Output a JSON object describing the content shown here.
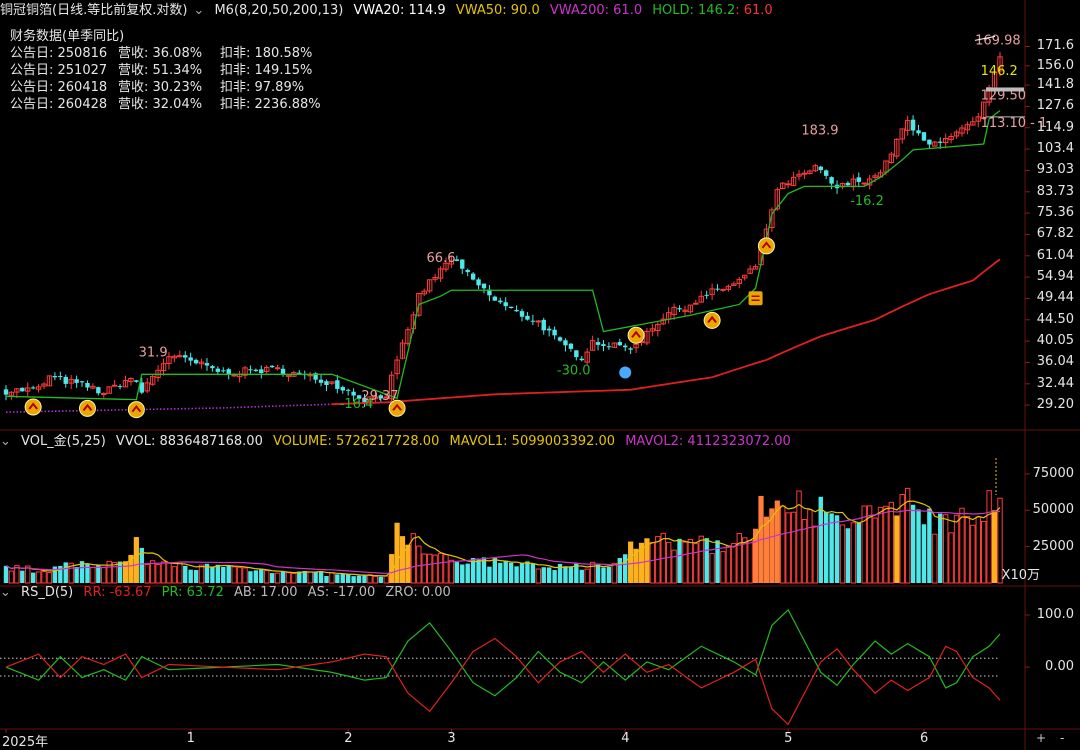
{
  "main_header": {
    "title": "铜冠铜箔(日线.等比前复权.对数)",
    "indicator": "M6(8,20,50,200,13)",
    "vwa20": "VWA20: 114.9",
    "vwa50": "VWA50: 90.0",
    "vwa200": "VWA200: 61.0",
    "hold": "HOLD: 146.2",
    "hold_extra": ": 61.0",
    "colors": {
      "vwa20": "#ffffff",
      "vwa50": "#e6c400",
      "vwa200": "#cc33cc",
      "hold": "#22bb22",
      "hold_extra": "#ff3333"
    }
  },
  "financial_box": {
    "title": "财务数据(单季同比)",
    "rows": [
      {
        "date": "公告日: 250816",
        "rev": "营收:  36.08%",
        "net": "扣非:  180.58%"
      },
      {
        "date": "公告日: 251027",
        "rev": "营收:  51.34%",
        "net": "扣非:  149.15%"
      },
      {
        "date": "公告日: 260418",
        "rev": "营收:  30.23%",
        "net": "扣非:  97.89%"
      },
      {
        "date": "公告日: 260428",
        "rev": "营收:  32.04%",
        "net": "扣非:  2236.88%"
      }
    ]
  },
  "vol_header": {
    "name": "VOL_金(5,25)",
    "vvol": "VVOL: 8836487168.00",
    "volume": "VOLUME: 5726217728.00",
    "mavol1": "MAVOL1: 5099003392.00",
    "mavol2": "MAVOL2: 4112323072.00"
  },
  "rs_header": {
    "name": "RS_D(5)",
    "rr": "RR: -63.67",
    "pr": "PR: 63.72",
    "ab": "AB: 17.00",
    "as": "AS: -17.00",
    "zro": "ZRO: 0.00"
  },
  "controls": {
    "plus": "+",
    "minus": "-"
  },
  "chart_data": [
    {
      "type": "candlestick",
      "scale": "log",
      "y_ticks": [
        "171.6",
        "156.0",
        "141.8",
        "127.6",
        "114.9",
        "103.4",
        "93.03",
        "83.73",
        "75.36",
        "67.82",
        "61.04",
        "54.94",
        "49.44",
        "44.50",
        "40.05",
        "36.04",
        "32.44",
        "29.20"
      ],
      "y_tick_values": [
        171.6,
        156.0,
        141.8,
        127.6,
        114.9,
        103.4,
        93.03,
        83.73,
        75.36,
        67.82,
        61.04,
        54.94,
        49.44,
        44.5,
        40.05,
        36.04,
        32.44,
        29.2
      ],
      "ylim": [
        26.6,
        188
      ],
      "x_ticks": [
        "2025年",
        "1",
        "2",
        "3",
        "4",
        "5",
        "6"
      ],
      "x_tick_index": [
        0,
        34,
        63,
        82,
        114,
        144,
        169
      ],
      "price_points": [
        [
          0,
          31.3
        ],
        [
          6,
          31.6
        ],
        [
          8,
          33.5
        ],
        [
          15,
          32.0
        ],
        [
          18,
          31.0
        ],
        [
          23,
          33.4
        ],
        [
          25,
          31.2
        ],
        [
          29,
          36.0
        ],
        [
          30,
          37.3
        ],
        [
          34,
          36.2
        ],
        [
          40,
          34.3
        ],
        [
          50,
          34.8
        ],
        [
          60,
          32.6
        ],
        [
          66,
          30.0
        ],
        [
          70,
          30.8
        ],
        [
          72,
          36.0
        ],
        [
          74,
          42.0
        ],
        [
          76,
          50.0
        ],
        [
          78,
          53.5
        ],
        [
          82,
          60.0
        ],
        [
          86,
          54.0
        ],
        [
          90,
          49.0
        ],
        [
          94,
          46.0
        ],
        [
          98,
          44.0
        ],
        [
          102,
          39.5
        ],
        [
          106,
          37.0
        ],
        [
          108,
          40.0
        ],
        [
          112,
          39.0
        ],
        [
          116,
          39.0
        ],
        [
          118,
          42.0
        ],
        [
          122,
          46.0
        ],
        [
          126,
          48.0
        ],
        [
          130,
          51.0
        ],
        [
          134,
          53.0
        ],
        [
          136,
          55.0
        ],
        [
          138,
          58.0
        ],
        [
          140,
          70.0
        ],
        [
          142,
          84.0
        ],
        [
          144,
          88.0
        ],
        [
          146,
          90.0
        ],
        [
          149,
          94.0
        ],
        [
          151,
          90.0
        ],
        [
          153,
          85.0
        ],
        [
          156,
          88.0
        ],
        [
          160,
          90.0
        ],
        [
          162,
          96.0
        ],
        [
          164,
          108.0
        ],
        [
          166,
          118.0
        ],
        [
          168,
          110.0
        ],
        [
          170,
          105.0
        ],
        [
          173,
          110.0
        ],
        [
          175,
          112.0
        ],
        [
          177,
          115.0
        ],
        [
          179,
          120.0
        ],
        [
          181,
          138.0
        ],
        [
          183,
          161.0
        ]
      ],
      "series": [
        {
          "name": "HOLD",
          "color": "#22bb22",
          "points": [
            [
              0,
              30.5
            ],
            [
              24,
              30.0
            ],
            [
              25,
              34.0
            ],
            [
              60,
              34.0
            ],
            [
              72,
              30.2
            ],
            [
              74,
              38.0
            ],
            [
              76,
              48.0
            ],
            [
              80,
              50.0
            ],
            [
              82,
              51.5
            ],
            [
              108,
              51.5
            ],
            [
              110,
              42.0
            ],
            [
              126,
              45.5
            ],
            [
              135,
              48.0
            ],
            [
              138,
              52.0
            ],
            [
              141,
              75.0
            ],
            [
              144,
              83.0
            ],
            [
              147,
              86.0
            ],
            [
              158,
              86.0
            ],
            [
              161,
              90.0
            ],
            [
              165,
              98.0
            ],
            [
              167,
              103.0
            ],
            [
              180,
              106.0
            ],
            [
              181,
              120.0
            ],
            [
              183,
              125.0
            ]
          ]
        },
        {
          "name": "VWA200",
          "color": "#e02020",
          "points": [
            [
              0,
              28.2
            ],
            [
              40,
              28.8
            ],
            [
              70,
              29.6
            ],
            [
              90,
              30.8
            ],
            [
              115,
              31.5
            ],
            [
              130,
              33.5
            ],
            [
              140,
              36.5
            ],
            [
              150,
              41.0
            ],
            [
              160,
              44.5
            ],
            [
              170,
              50.5
            ],
            [
              178,
              54.0
            ],
            [
              183,
              60.0
            ]
          ]
        }
      ],
      "annotations": [
        {
          "text": "169.98",
          "x": 181,
          "y": 169.98
        },
        {
          "text": "146.2",
          "x": 182,
          "y": 146.2,
          "color": "#e6e600"
        },
        {
          "text": "129.50",
          "x": 182,
          "y": 129.5
        },
        {
          "text": "113.10 - 1",
          "x": 182,
          "y": 113.1
        },
        {
          "text": "183.9",
          "x": 149,
          "y": 109
        },
        {
          "text": "66.6",
          "x": 80,
          "y": 58
        },
        {
          "text": "31.9",
          "x": 27,
          "y": 36.4
        },
        {
          "text": "29.37",
          "x": 68,
          "y": 29.37
        },
        {
          "text": "-30.0",
          "x": 104,
          "y": 33.3,
          "color": "#22bb22"
        },
        {
          "text": "-16.2",
          "x": 158,
          "y": 77,
          "color": "#22bb22"
        },
        {
          "text": "-16.4",
          "x": 64,
          "y": 28.2,
          "color": "#22bb22"
        }
      ],
      "signal_markers": [
        5,
        15,
        24,
        72,
        116,
        130,
        138,
        140
      ]
    },
    {
      "type": "bar",
      "name": "VOL",
      "y_ticks": [
        "75000",
        "50000",
        "25000"
      ],
      "y_tick_values": [
        75000,
        50000,
        25000
      ],
      "unit_label": "X10万",
      "ylim": [
        0,
        88000
      ],
      "volume_anchors": [
        [
          0,
          10000
        ],
        [
          8,
          9000
        ],
        [
          14,
          14000
        ],
        [
          22,
          12000
        ],
        [
          24,
          28000
        ],
        [
          26,
          13000
        ],
        [
          40,
          11000
        ],
        [
          60,
          6000
        ],
        [
          70,
          4000
        ],
        [
          72,
          40000
        ],
        [
          74,
          34000
        ],
        [
          76,
          24000
        ],
        [
          80,
          17000
        ],
        [
          90,
          14000
        ],
        [
          100,
          11000
        ],
        [
          110,
          12000
        ],
        [
          116,
          28000
        ],
        [
          118,
          30000
        ],
        [
          122,
          27000
        ],
        [
          130,
          26000
        ],
        [
          136,
          30000
        ],
        [
          138,
          42000
        ],
        [
          140,
          55000
        ],
        [
          142,
          60000
        ],
        [
          144,
          63000
        ],
        [
          146,
          58000
        ],
        [
          148,
          54000
        ],
        [
          150,
          48000
        ],
        [
          152,
          44000
        ],
        [
          156,
          38000
        ],
        [
          160,
          48000
        ],
        [
          164,
          58000
        ],
        [
          166,
          60000
        ],
        [
          168,
          54000
        ],
        [
          172,
          40000
        ],
        [
          176,
          48000
        ],
        [
          180,
          55000
        ],
        [
          182,
          65000
        ],
        [
          183,
          60000
        ]
      ],
      "orange_ranges": [
        [
          22,
          24
        ],
        [
          71,
          74
        ],
        [
          115,
          118
        ],
        [
          138,
          142
        ],
        [
          164,
          164
        ],
        [
          182,
          182
        ]
      ],
      "series": [
        {
          "name": "MAVOL1",
          "color": "#e6c400"
        },
        {
          "name": "MAVOL2",
          "color": "#cc33cc"
        }
      ]
    },
    {
      "type": "line",
      "name": "RS_D",
      "y_ticks": [
        "100.0",
        "0.00"
      ],
      "y_tick_values": [
        100,
        0
      ],
      "ylim": [
        -115,
        125
      ],
      "hlines": [
        17,
        -17
      ],
      "series": [
        {
          "name": "PR",
          "color": "#22bb22",
          "points": [
            [
              0,
              0
            ],
            [
              6,
              -25
            ],
            [
              10,
              20
            ],
            [
              14,
              -20
            ],
            [
              18,
              -5
            ],
            [
              22,
              -25
            ],
            [
              25,
              20
            ],
            [
              30,
              -5
            ],
            [
              40,
              0
            ],
            [
              50,
              5
            ],
            [
              60,
              -10
            ],
            [
              66,
              -25
            ],
            [
              70,
              -20
            ],
            [
              74,
              50
            ],
            [
              78,
              85
            ],
            [
              82,
              30
            ],
            [
              86,
              -30
            ],
            [
              90,
              -55
            ],
            [
              94,
              -20
            ],
            [
              98,
              30
            ],
            [
              102,
              -10
            ],
            [
              106,
              -30
            ],
            [
              110,
              10
            ],
            [
              114,
              -25
            ],
            [
              118,
              10
            ],
            [
              122,
              -5
            ],
            [
              128,
              40
            ],
            [
              134,
              10
            ],
            [
              138,
              -15
            ],
            [
              141,
              80
            ],
            [
              144,
              110
            ],
            [
              147,
              50
            ],
            [
              150,
              -10
            ],
            [
              153,
              -35
            ],
            [
              156,
              5
            ],
            [
              160,
              50
            ],
            [
              163,
              25
            ],
            [
              166,
              45
            ],
            [
              170,
              20
            ],
            [
              173,
              -40
            ],
            [
              175,
              -30
            ],
            [
              178,
              20
            ],
            [
              181,
              40
            ],
            [
              183,
              63.72
            ]
          ]
        },
        {
          "name": "RR",
          "color": "#e02020",
          "points": [
            [
              0,
              0
            ],
            [
              6,
              25
            ],
            [
              10,
              -20
            ],
            [
              14,
              20
            ],
            [
              18,
              5
            ],
            [
              22,
              25
            ],
            [
              25,
              -20
            ],
            [
              30,
              5
            ],
            [
              40,
              0
            ],
            [
              50,
              -5
            ],
            [
              60,
              10
            ],
            [
              66,
              25
            ],
            [
              70,
              20
            ],
            [
              74,
              -50
            ],
            [
              78,
              -85
            ],
            [
              82,
              -30
            ],
            [
              86,
              30
            ],
            [
              90,
              55
            ],
            [
              94,
              20
            ],
            [
              98,
              -30
            ],
            [
              102,
              10
            ],
            [
              106,
              30
            ],
            [
              110,
              -10
            ],
            [
              114,
              25
            ],
            [
              118,
              -10
            ],
            [
              122,
              5
            ],
            [
              128,
              -40
            ],
            [
              134,
              -10
            ],
            [
              138,
              15
            ],
            [
              141,
              -80
            ],
            [
              144,
              -110
            ],
            [
              147,
              -50
            ],
            [
              150,
              10
            ],
            [
              153,
              35
            ],
            [
              156,
              -5
            ],
            [
              160,
              -50
            ],
            [
              163,
              -25
            ],
            [
              166,
              -45
            ],
            [
              170,
              -20
            ],
            [
              173,
              40
            ],
            [
              175,
              30
            ],
            [
              178,
              -20
            ],
            [
              181,
              -40
            ],
            [
              183,
              -63.67
            ]
          ]
        }
      ]
    }
  ]
}
